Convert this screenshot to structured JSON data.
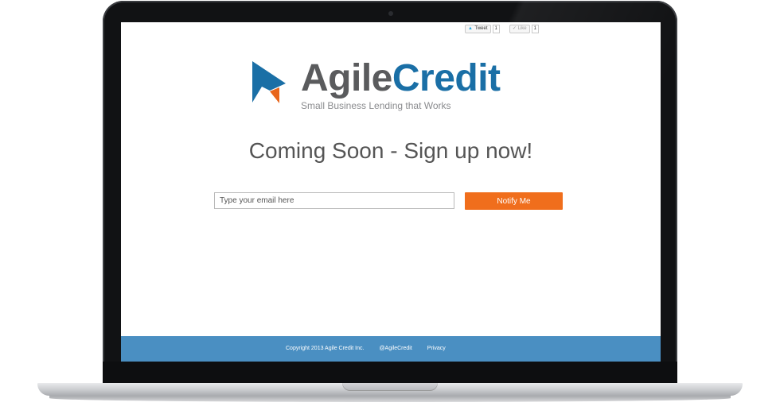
{
  "social": {
    "tweet_label": "Tweet",
    "tweet_count": "1",
    "like_label": "Like",
    "like_count": "1"
  },
  "logo": {
    "name_part1": "Agile",
    "name_part2": "Credit",
    "tagline": "Small Business Lending that Works",
    "colors": {
      "primary": "#1a6fa6",
      "accent": "#e8651b",
      "text": "#5a5b5d"
    }
  },
  "headline": "Coming Soon - Sign up now!",
  "signup": {
    "email_placeholder": "Type your email here",
    "email_value": "",
    "button_label": "Notify Me",
    "button_color": "#f06e1c"
  },
  "footer": {
    "copyright": "Copyright 2013 Agile Credit Inc.",
    "twitter_link": "@AgileCredit",
    "privacy_link": "Privacy",
    "color": "#4a8fc2"
  }
}
